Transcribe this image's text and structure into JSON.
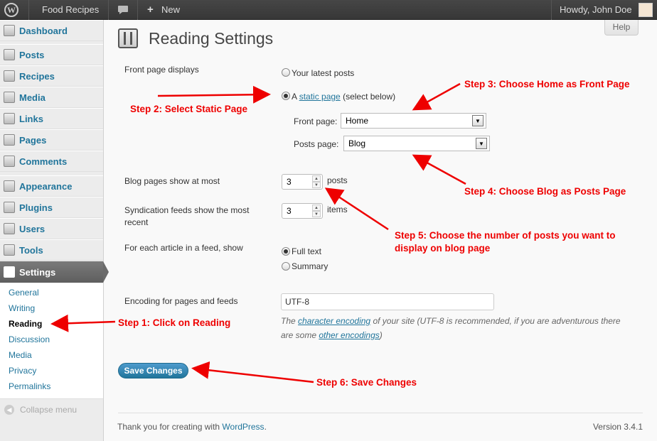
{
  "adminbar": {
    "site_name": "Food Recipes",
    "new_label": "New",
    "greeting": "Howdy, John Doe"
  },
  "sidebar": {
    "items": [
      {
        "label": "Dashboard",
        "icon": "dashboard-icon"
      },
      {
        "label": "Posts",
        "icon": "pin-icon"
      },
      {
        "label": "Recipes",
        "icon": "pin-icon"
      },
      {
        "label": "Media",
        "icon": "media-icon"
      },
      {
        "label": "Links",
        "icon": "links-icon"
      },
      {
        "label": "Pages",
        "icon": "pages-icon"
      },
      {
        "label": "Comments",
        "icon": "comments-icon"
      },
      {
        "label": "Appearance",
        "icon": "appearance-icon"
      },
      {
        "label": "Plugins",
        "icon": "plugins-icon"
      },
      {
        "label": "Users",
        "icon": "users-icon"
      },
      {
        "label": "Tools",
        "icon": "tools-icon"
      },
      {
        "label": "Settings",
        "icon": "settings-icon"
      }
    ],
    "submenu": [
      "General",
      "Writing",
      "Reading",
      "Discussion",
      "Media",
      "Privacy",
      "Permalinks"
    ],
    "collapse_label": "Collapse menu"
  },
  "help_label": "Help",
  "page_title": "Reading Settings",
  "form": {
    "front_page_displays": "Front page displays",
    "your_latest_posts": "Your latest posts",
    "static_prefix": "A",
    "static_link": "static page",
    "static_suffix": "(select below)",
    "front_page_label": "Front page:",
    "front_page_value": "Home",
    "posts_page_label": "Posts page:",
    "posts_page_value": "Blog",
    "blog_pages_label": "Blog pages show at most",
    "blog_pages_value": "3",
    "blog_pages_unit": "posts",
    "syndication_label_1": "Syndication feeds show the most",
    "syndication_label_2": "recent",
    "syndication_value": "3",
    "syndication_unit": "items",
    "feed_show_label": "For each article in a feed, show",
    "full_text": "Full text",
    "summary": "Summary",
    "encoding_label": "Encoding for pages and feeds",
    "encoding_value": "UTF-8",
    "encoding_desc_1": "The",
    "encoding_desc_link1": "character encoding",
    "encoding_desc_2": "of your site (UTF-8 is recommended, if you are adventurous there",
    "encoding_desc_3": "are some",
    "encoding_desc_link2": "other encodings",
    "encoding_desc_4": ")",
    "save_label": "Save Changes"
  },
  "footer": {
    "thanks": "Thank you for creating with",
    "wp_link": "WordPress",
    "period": ".",
    "version": "Version 3.4.1"
  },
  "annotations": {
    "step1": "Step 1: Click on Reading",
    "step2": "Step 2: Select Static Page",
    "step3": "Step 3: Choose Home as Front Page",
    "step4": "Step 4: Choose Blog as Posts Page",
    "step5_line1": "Step 5: Choose the number of posts you want to",
    "step5_line2": "display on blog page",
    "step6": "Step 6: Save Changes"
  },
  "colors": {
    "link": "#21759b",
    "annotation": "#e00000",
    "primary_button": "#21759b",
    "current_menu": "#6b6b6b"
  }
}
